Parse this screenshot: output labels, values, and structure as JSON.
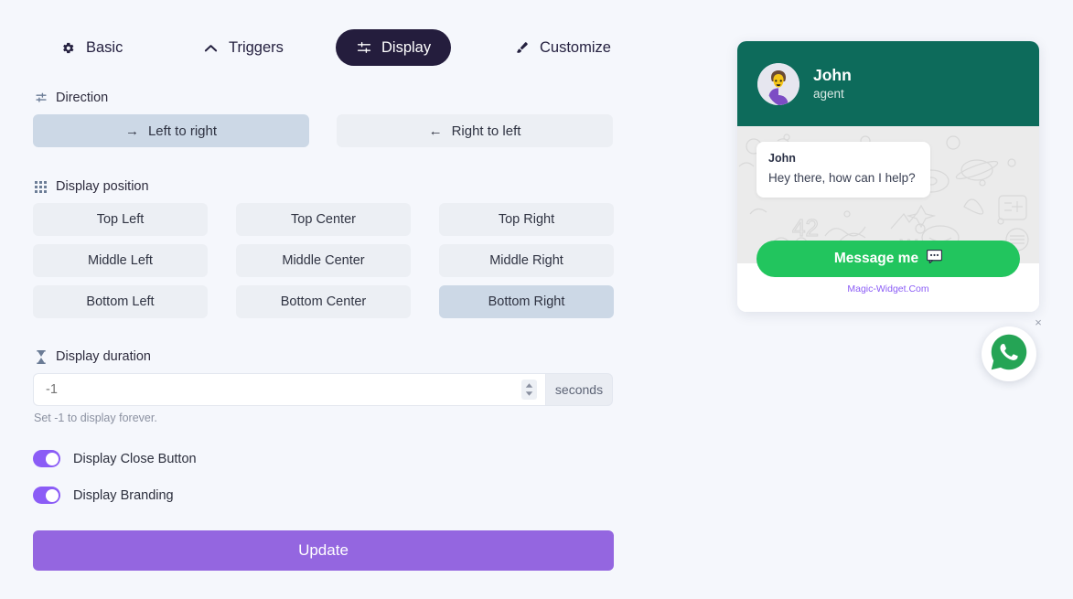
{
  "tabs": [
    {
      "id": "basic",
      "label": "Basic",
      "icon": "gear-icon",
      "active": false
    },
    {
      "id": "triggers",
      "label": "Triggers",
      "icon": "chevron-up-icon",
      "active": false
    },
    {
      "id": "display",
      "label": "Display",
      "icon": "sliders-icon",
      "active": true
    },
    {
      "id": "customize",
      "label": "Customize",
      "icon": "brush-icon",
      "active": false
    }
  ],
  "direction": {
    "label": "Direction",
    "icon": "sliders-vertical-icon",
    "options": [
      {
        "label": "Left to right",
        "arrow": "→",
        "selected": true
      },
      {
        "label": "Right to left",
        "arrow": "←",
        "selected": false
      }
    ]
  },
  "display_position": {
    "label": "Display position",
    "icon": "grid-icon",
    "options": [
      {
        "label": "Top Left",
        "selected": false
      },
      {
        "label": "Top Center",
        "selected": false
      },
      {
        "label": "Top Right",
        "selected": false
      },
      {
        "label": "Middle Left",
        "selected": false
      },
      {
        "label": "Middle Center",
        "selected": false
      },
      {
        "label": "Middle Right",
        "selected": false
      },
      {
        "label": "Bottom Left",
        "selected": false
      },
      {
        "label": "Bottom Center",
        "selected": false
      },
      {
        "label": "Bottom Right",
        "selected": true
      }
    ]
  },
  "display_duration": {
    "label": "Display duration",
    "icon": "hourglass-icon",
    "value": "-1",
    "placeholder": "-1",
    "unit": "seconds",
    "hint": "Set -1 to display forever."
  },
  "toggles": [
    {
      "label": "Display Close Button",
      "on": true
    },
    {
      "label": "Display Branding",
      "on": true
    }
  ],
  "update_button": {
    "label": "Update"
  },
  "widget": {
    "header": {
      "name": "John",
      "role": "agent",
      "avatar_icon": "person-avatar-icon"
    },
    "message": {
      "sender": "John",
      "text": "Hey there, how can I help?"
    },
    "cta": {
      "label": "Message me",
      "icon": "speech-balloon-icon"
    },
    "branding": {
      "label": "Magic-Widget.Com"
    }
  },
  "floating_button": {
    "icon": "whatsapp-icon",
    "close_label": "×"
  },
  "colors": {
    "page_background": "#f5f7fc",
    "tab_active_background": "#241d3d",
    "option_background": "#eceff4",
    "option_selected_background": "#ccd8e6",
    "toggle_on": "#8b5cf6",
    "update_button": "#9466e0",
    "widget_header": "#0d6b5b",
    "cta_green": "#22c55e",
    "branding_purple": "#8b5cf6"
  }
}
